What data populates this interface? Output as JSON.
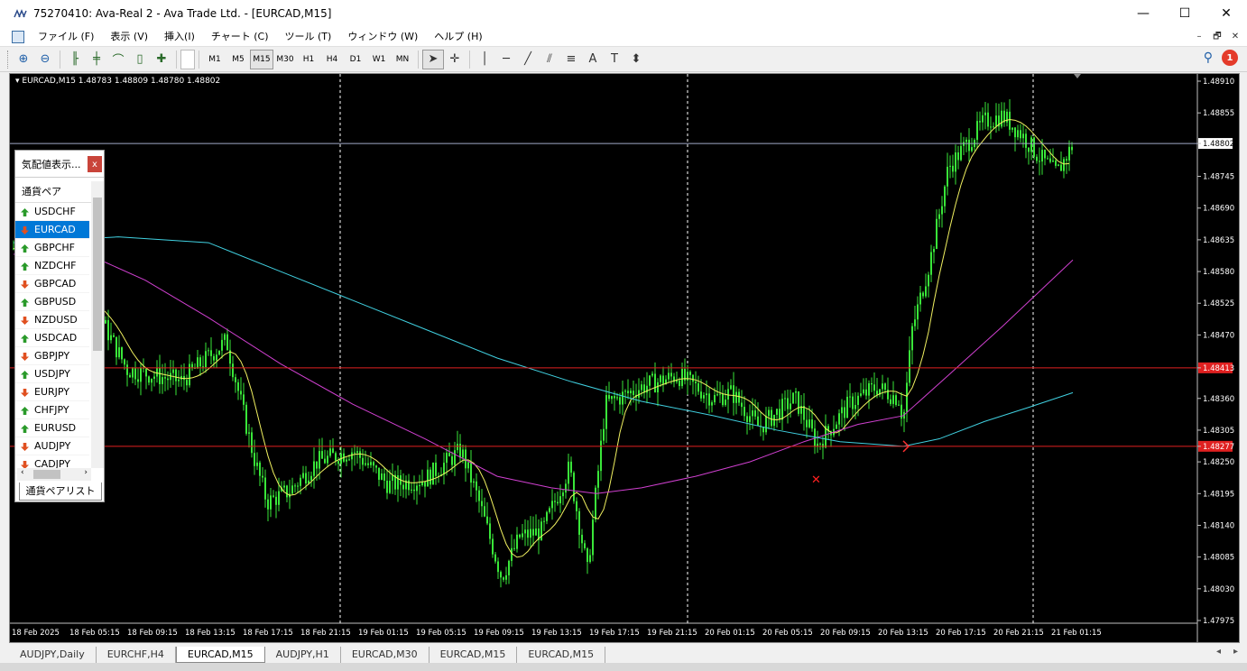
{
  "window": {
    "title": "75270410: Ava-Real 2 - Ava Trade Ltd. - [EURCAD,M15]",
    "minimize": "—",
    "maximize": "☐",
    "close": "✕"
  },
  "menu": [
    "ファイル (F)",
    "表示 (V)",
    "挿入(I)",
    "チャート (C)",
    "ツール (T)",
    "ウィンドウ (W)",
    "ヘルプ (H)"
  ],
  "mdi": {
    "min": "–",
    "restore": "🗗",
    "close": "✕"
  },
  "timeframes": [
    "M1",
    "M5",
    "M15",
    "M30",
    "H1",
    "H4",
    "D1",
    "W1",
    "MN"
  ],
  "active_timeframe": "M15",
  "notification_count": "1",
  "chart": {
    "symbol_info": "EURCAD,M15  1.48783 1.48809 1.48780 1.48802",
    "price_labels": [
      "1.48910",
      "1.48855",
      "1.48802",
      "1.48745",
      "1.48690",
      "1.48635",
      "1.48580",
      "1.48525",
      "1.48470",
      "1.48413",
      "1.48360",
      "1.48305",
      "1.48277",
      "1.48250",
      "1.48195",
      "1.48140",
      "1.48085",
      "1.48030",
      "1.47975"
    ],
    "time_labels": [
      "18 Feb 2025",
      "18 Feb 05:15",
      "18 Feb 09:15",
      "18 Feb 13:15",
      "18 Feb 17:15",
      "18 Feb 21:15",
      "19 Feb 01:15",
      "19 Feb 05:15",
      "19 Feb 09:15",
      "19 Feb 13:15",
      "19 Feb 17:15",
      "19 Feb 21:15",
      "20 Feb 01:15",
      "20 Feb 05:15",
      "20 Feb 09:15",
      "20 Feb 13:15",
      "20 Feb 17:15",
      "20 Feb 21:15",
      "21 Feb 01:15"
    ],
    "colors": {
      "background": "#000000",
      "candle": "#39e639",
      "ma_fast": "#f0f060",
      "ma_mid": "#d040d0",
      "ma_slow": "#40d0e0",
      "hline": "#e02020",
      "bid_line": "#a0a8c8"
    }
  },
  "market_watch": {
    "title": "気配値表示...",
    "close": "x",
    "column": "通貨ペア",
    "tab": "通貨ペアリスト",
    "items": [
      {
        "symbol": "USDCHF",
        "dir": "up"
      },
      {
        "symbol": "EURCAD",
        "dir": "down"
      },
      {
        "symbol": "GBPCHF",
        "dir": "up"
      },
      {
        "symbol": "NZDCHF",
        "dir": "up"
      },
      {
        "symbol": "GBPCAD",
        "dir": "down"
      },
      {
        "symbol": "GBPUSD",
        "dir": "up"
      },
      {
        "symbol": "NZDUSD",
        "dir": "down"
      },
      {
        "symbol": "USDCAD",
        "dir": "up"
      },
      {
        "symbol": "GBPJPY",
        "dir": "down"
      },
      {
        "symbol": "USDJPY",
        "dir": "up"
      },
      {
        "symbol": "EURJPY",
        "dir": "down"
      },
      {
        "symbol": "CHFJPY",
        "dir": "up"
      },
      {
        "symbol": "EURUSD",
        "dir": "up"
      },
      {
        "symbol": "AUDJPY",
        "dir": "down"
      },
      {
        "symbol": "CADJPY",
        "dir": "down"
      }
    ]
  },
  "chart_tabs": [
    "AUDJPY,Daily",
    "EURCHF,H4",
    "EURCAD,M15",
    "AUDJPY,H1",
    "EURCAD,M30",
    "EURCAD,M15",
    "EURCAD,M15"
  ],
  "active_chart_tab": "EURCAD,M15"
}
